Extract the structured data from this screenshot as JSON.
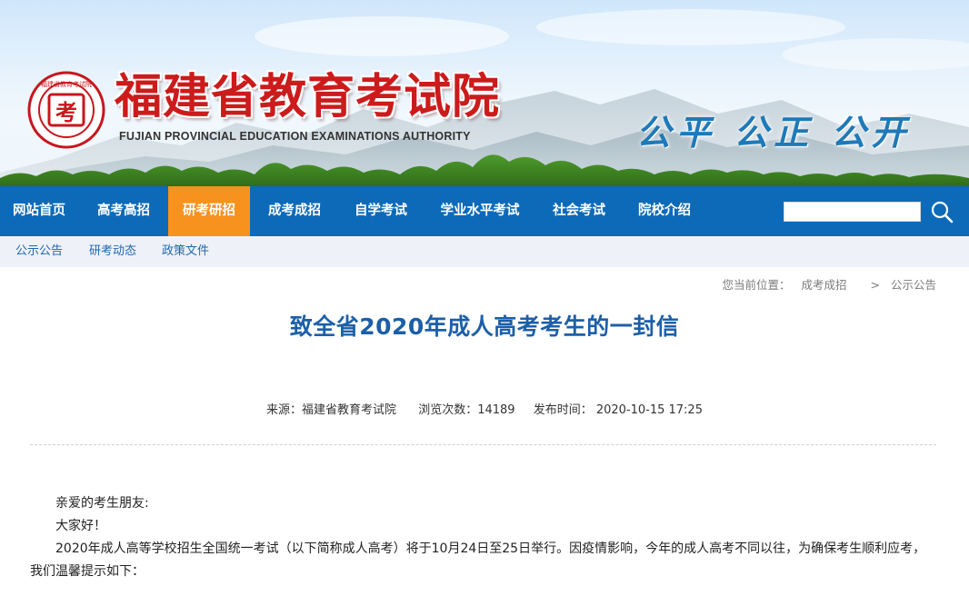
{
  "header": {
    "title_cn": "福建省教育考试院",
    "title_en": "FUJIAN PROVINCIAL EDUCATION EXAMINATIONS AUTHORITY",
    "slogan": "公平 公正 公开",
    "seal_char": "考",
    "seal_ring_text": "福建省教育考试院"
  },
  "nav": {
    "items": [
      {
        "label": "网站首页"
      },
      {
        "label": "高考高招"
      },
      {
        "label": "研考研招",
        "active": true
      },
      {
        "label": "成考成招"
      },
      {
        "label": "自学考试"
      },
      {
        "label": "学业水平考试"
      },
      {
        "label": "社会考试"
      },
      {
        "label": "院校介绍"
      }
    ],
    "search": {
      "value": "",
      "placeholder": ""
    },
    "search_icon": "search-icon"
  },
  "subnav": {
    "items": [
      {
        "label": "公示公告"
      },
      {
        "label": "研考动态"
      },
      {
        "label": "政策文件"
      }
    ]
  },
  "breadcrumb": {
    "prefix": "您当前位置：",
    "items": [
      "成考成招",
      "公示公告"
    ],
    "separator": ">"
  },
  "article": {
    "title": "致全省2020年成人高考考生的一封信",
    "source_label": "来源：福建省教育考试院",
    "views_label": "浏览次数：14189",
    "date_label": "发布时间： 2020-10-15 17:25",
    "greeting": "亲爱的考生朋友:",
    "hello": "大家好！",
    "paragraph1": "2020年成人高等学校招生全国统一考试（以下简称成人高考）将于10月24日至25日举行。因疫情影响，今年的成人高考不同以往，为确保考生顺利应考，我们温馨提示如下："
  },
  "colors": {
    "nav_bg": "#0d6ab8",
    "nav_active": "#f8921e",
    "title_red": "#cc1b1b",
    "slogan_blue": "#1f79b8",
    "article_title": "#1c5fa8",
    "subnav_bg": "#eef1f8"
  }
}
